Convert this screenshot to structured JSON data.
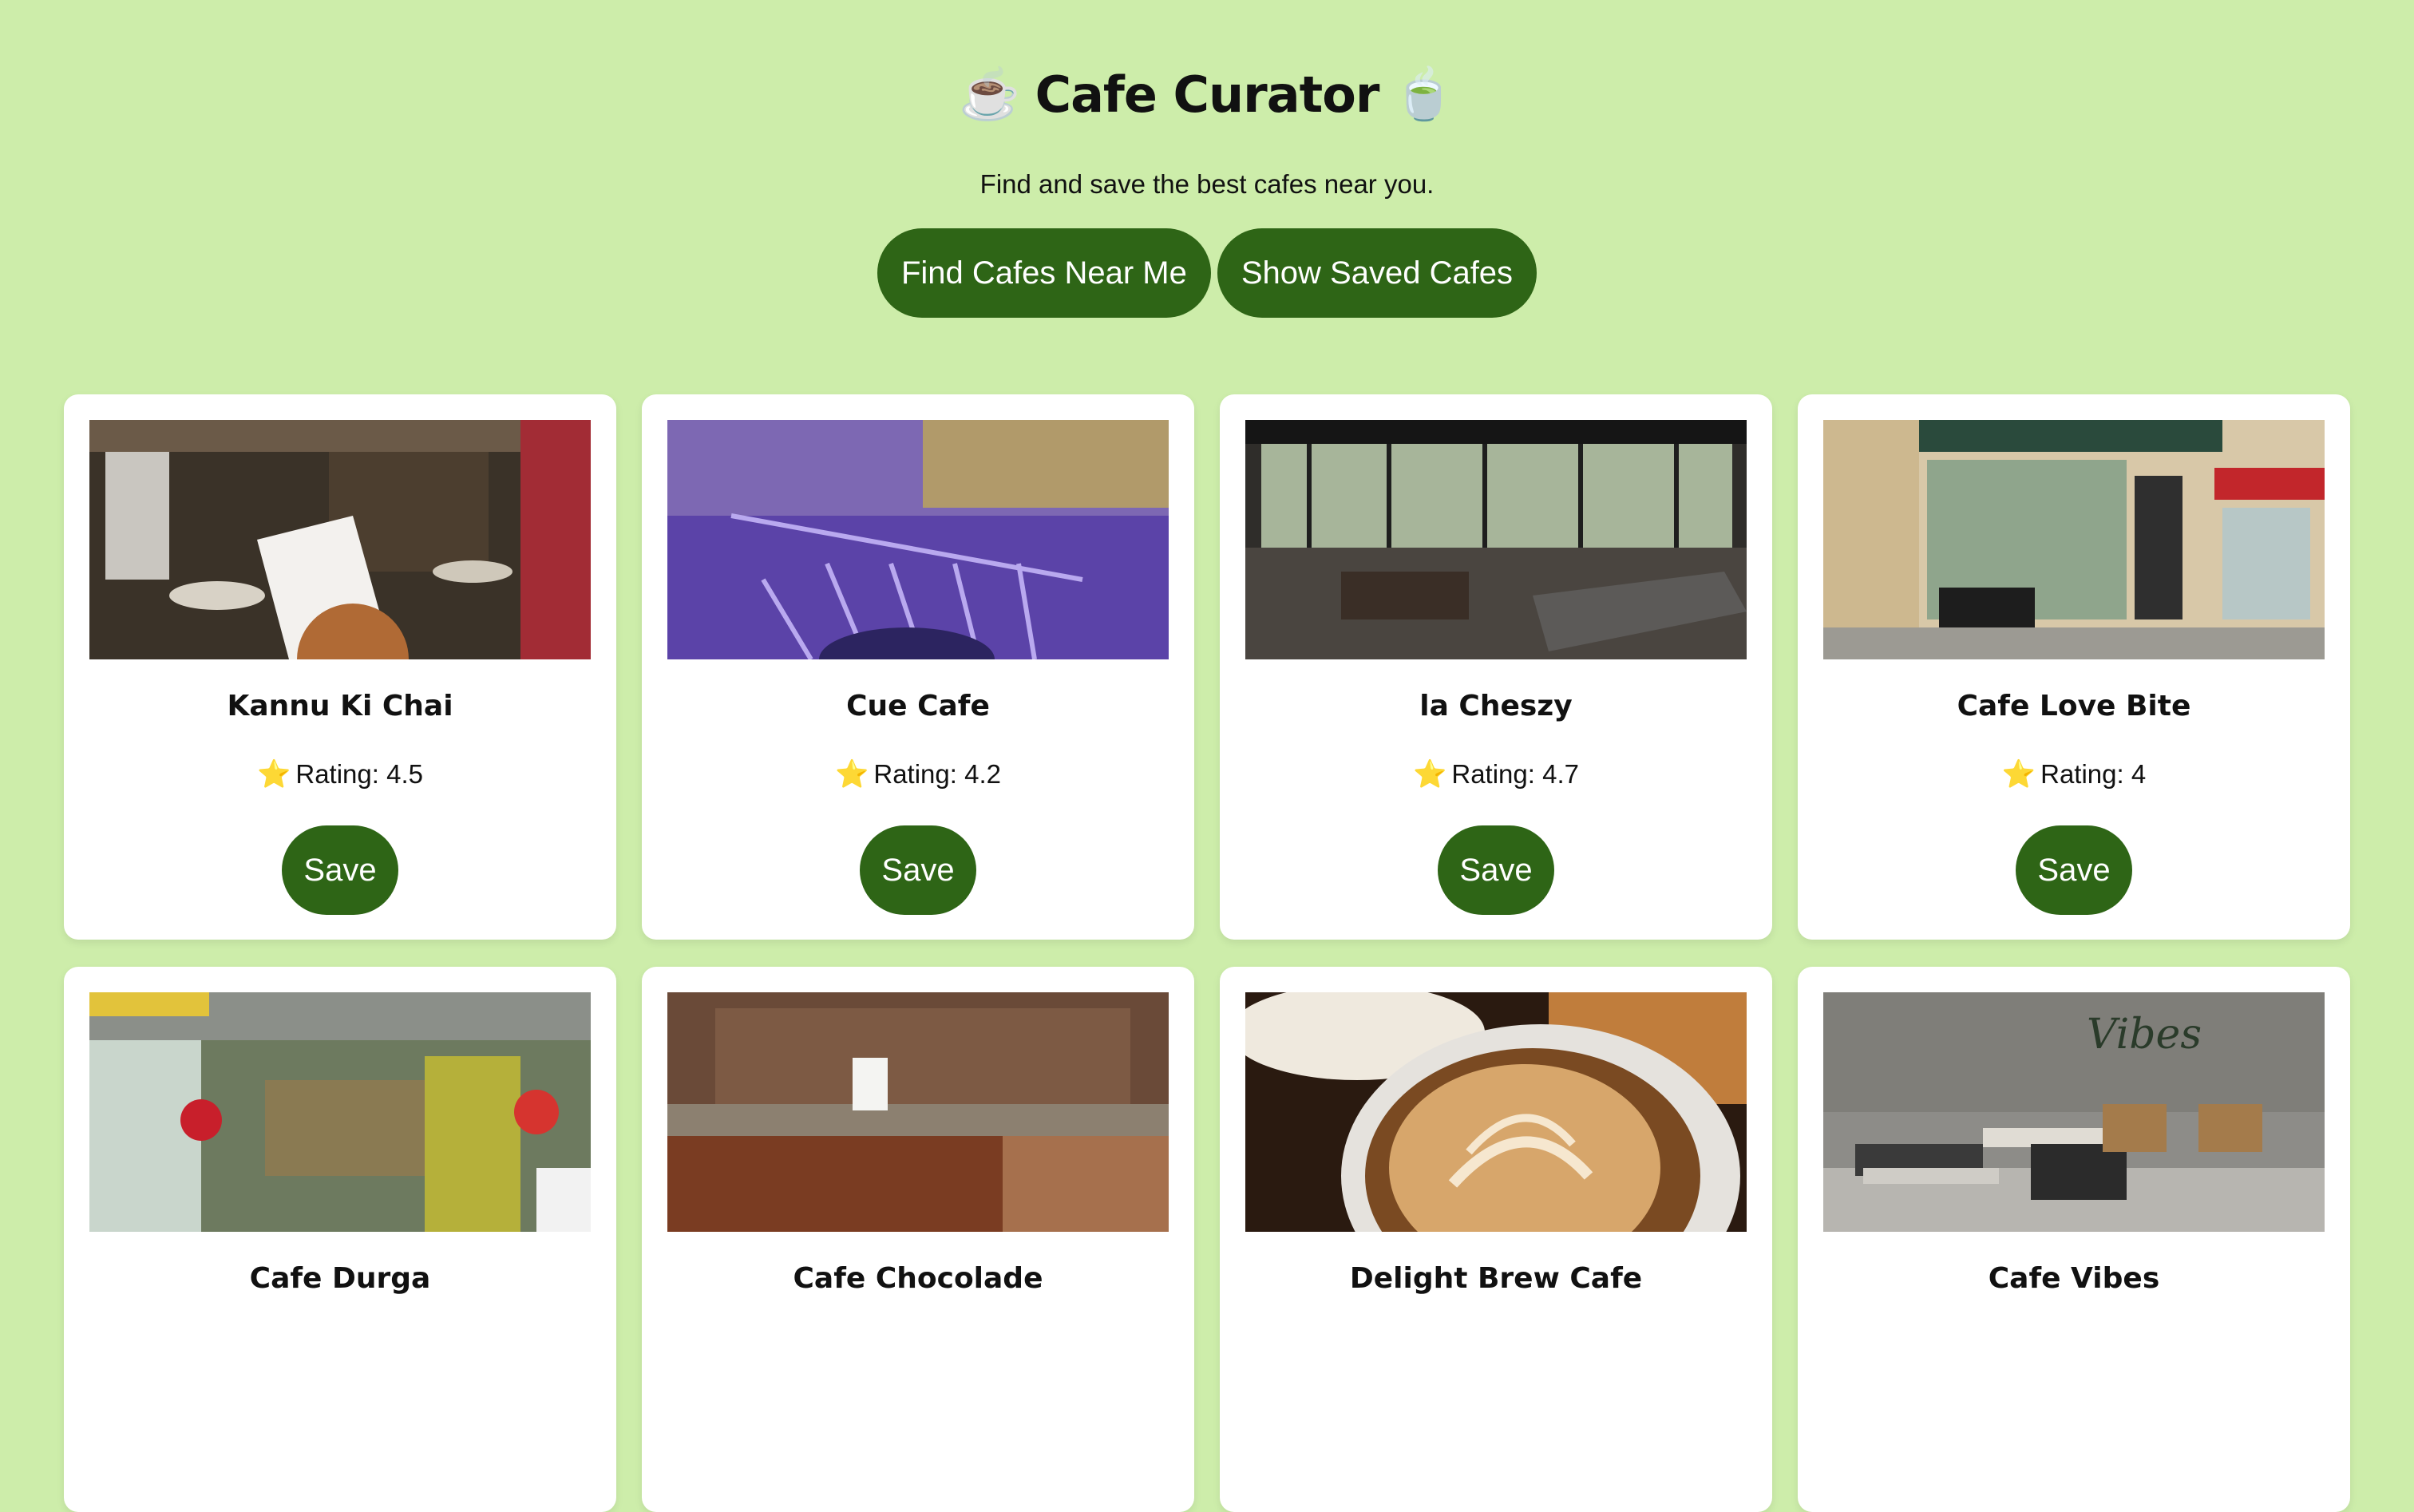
{
  "app": {
    "title": "Cafe Curator",
    "title_left_icon": "☕",
    "title_right_icon": "🍵",
    "subtitle": "Find and save the best cafes near you."
  },
  "actions": {
    "find_label": "Find Cafes Near Me",
    "saved_label": "Show Saved Cafes"
  },
  "colors": {
    "background": "#cdedaa",
    "accent": "#2e6516",
    "card": "#ffffff",
    "star": "#f4c21b"
  },
  "cafes": [
    {
      "name": "Kannu Ki Chai",
      "rating_text": "Rating: 4.5",
      "save_label": "Save",
      "star_icon": "⭐"
    },
    {
      "name": "Cue Cafe",
      "rating_text": "Rating: 4.2",
      "save_label": "Save",
      "star_icon": "⭐"
    },
    {
      "name": "la Cheszy",
      "rating_text": "Rating: 4.7",
      "save_label": "Save",
      "star_icon": "⭐"
    },
    {
      "name": "Cafe Love Bite",
      "rating_text": "Rating: 4",
      "save_label": "Save",
      "star_icon": "⭐"
    },
    {
      "name": "Cafe Durga",
      "rating_text": "",
      "save_label": "",
      "star_icon": ""
    },
    {
      "name": "Cafe Chocolade",
      "rating_text": "",
      "save_label": "",
      "star_icon": ""
    },
    {
      "name": "Delight Brew Cafe",
      "rating_text": "",
      "save_label": "",
      "star_icon": ""
    },
    {
      "name": "Cafe Vibes",
      "rating_text": "",
      "save_label": "",
      "star_icon": ""
    }
  ]
}
